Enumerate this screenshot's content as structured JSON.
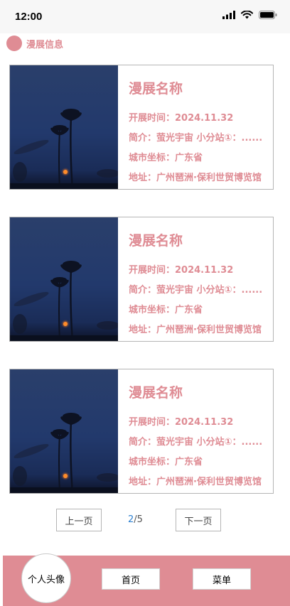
{
  "status_bar": {
    "time": "12:00",
    "icons": [
      "signal-icon",
      "wifi-icon",
      "battery-icon"
    ]
  },
  "section": {
    "title": "漫展信息"
  },
  "exhibitions": [
    {
      "title": "漫展名称",
      "date": "开展时间：2024.11.32",
      "intro": "简介：萤光宇宙 小分站①：......",
      "city": "城市坐标：广东省",
      "address": "地址：广州琶洲·保利世贸博览馆"
    },
    {
      "title": "漫展名称",
      "date": "开展时间：2024.11.32",
      "intro": "简介：萤光宇宙 小分站①：......",
      "city": "城市坐标：广东省",
      "address": "地址：广州琶洲·保利世贸博览馆"
    },
    {
      "title": "漫展名称",
      "date": "开展时间：2024.11.32",
      "intro": "简介：萤光宇宙 小分站①：......",
      "city": "城市坐标：广东省",
      "address": "地址：广州琶洲·保利世贸博览馆"
    }
  ],
  "pagination": {
    "prev_label": "上一页",
    "current": "2",
    "separator": "/",
    "total": "5",
    "next_label": "下一页"
  },
  "bottom_nav": {
    "avatar_label": "个人头像",
    "home_label": "首页",
    "menu_label": "菜单"
  },
  "colors": {
    "accent": "#df8c94",
    "page_current": "#2b7fd0",
    "border": "#b5b5b5"
  }
}
